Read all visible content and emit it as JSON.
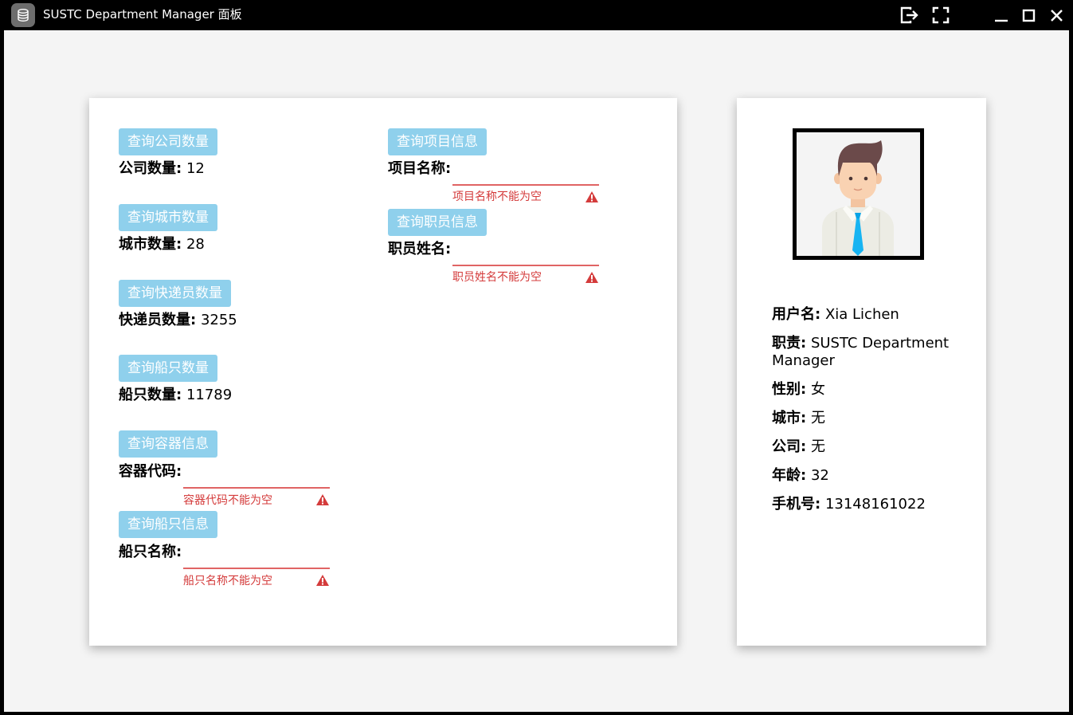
{
  "window": {
    "title": "SUSTC Department Manager 面板"
  },
  "queries": {
    "company_count": {
      "button": "查询公司数量",
      "label": "公司数量:",
      "value": "12"
    },
    "city_count": {
      "button": "查询城市数量",
      "label": "城市数量:",
      "value": "28"
    },
    "courier_count": {
      "button": "查询快递员数量",
      "label": "快递员数量:",
      "value": "3255"
    },
    "ship_count": {
      "button": "查询船只数量",
      "label": "船只数量:",
      "value": "11789"
    },
    "container_info": {
      "button": "查询容器信息",
      "label": "容器代码:",
      "value": "",
      "error": "容器代码不能为空"
    },
    "ship_info": {
      "button": "查询船只信息",
      "label": "船只名称:",
      "value": "",
      "error": "船只名称不能为空"
    },
    "item_info": {
      "button": "查询项目信息",
      "label": "项目名称:",
      "value": "",
      "error": "项目名称不能为空"
    },
    "staff_info": {
      "button": "查询职员信息",
      "label": "职员姓名:",
      "value": "",
      "error": "职员姓名不能为空"
    }
  },
  "profile": {
    "username_label": "用户名:",
    "username": "Xia Lichen",
    "role_label": "职责:",
    "role": "SUSTC Department Manager",
    "gender_label": "性别:",
    "gender": "女",
    "city_label": "城市:",
    "city": "无",
    "company_label": "公司:",
    "company": "无",
    "age_label": "年龄:",
    "age": "32",
    "phone_label": "手机号:",
    "phone": "13148161022"
  },
  "icons": {
    "app": "database-icon",
    "logout": "logout-icon",
    "fullscreen": "fullscreen-icon",
    "minimize": "minimize-icon",
    "maximize": "maximize-icon",
    "close": "close-icon",
    "warning": "warning-icon",
    "avatar": "avatar-icon"
  },
  "colors": {
    "button_bg": "#8fd0ec",
    "error": "#d43b3b",
    "background": "#f4f4f4",
    "titlebar": "#000000"
  }
}
